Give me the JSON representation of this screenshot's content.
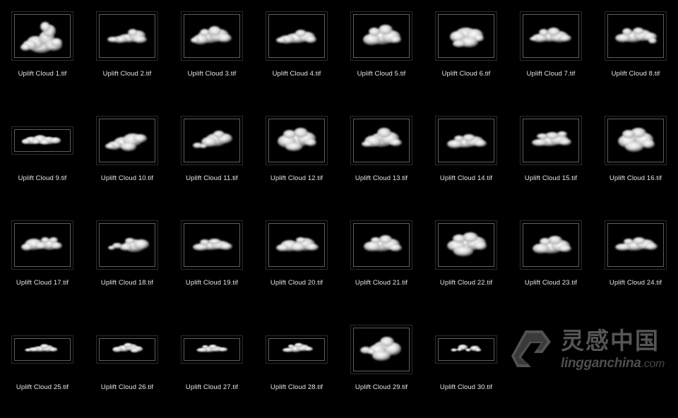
{
  "background_color": "#000000",
  "label_color": "#e6e6e6",
  "frame_border_color": "#5e5e5e",
  "grid": {
    "columns": 8,
    "rows": 4,
    "total_items": 30
  },
  "items": [
    {
      "label": "Uplift Cloud 1.tif",
      "shape": "towering-cumulus",
      "frame": "tall"
    },
    {
      "label": "Uplift Cloud 2.tif",
      "shape": "flat-wisp",
      "frame": "tall"
    },
    {
      "label": "Uplift Cloud 3.tif",
      "shape": "broad-puffy",
      "frame": "tall"
    },
    {
      "label": "Uplift Cloud 4.tif",
      "shape": "lumpy-low",
      "frame": "tall"
    },
    {
      "label": "Uplift Cloud 5.tif",
      "shape": "dome-cumulus",
      "frame": "tall"
    },
    {
      "label": "Uplift Cloud 6.tif",
      "shape": "round-blob",
      "frame": "tall"
    },
    {
      "label": "Uplift Cloud 7.tif",
      "shape": "long-flat",
      "frame": "tall"
    },
    {
      "label": "Uplift Cloud 8.tif",
      "shape": "ragged-wide",
      "frame": "tall"
    },
    {
      "label": "Uplift Cloud 9.tif",
      "shape": "panorama-bank",
      "frame": "wide"
    },
    {
      "label": "Uplift Cloud 10.tif",
      "shape": "diagonal-streak",
      "frame": "tall"
    },
    {
      "label": "Uplift Cloud 11.tif",
      "shape": "split-fragment",
      "frame": "tall"
    },
    {
      "label": "Uplift Cloud 12.tif",
      "shape": "dense-mass",
      "frame": "tall"
    },
    {
      "label": "Uplift Cloud 13.tif",
      "shape": "billowy-top",
      "frame": "tall"
    },
    {
      "label": "Uplift Cloud 14.tif",
      "shape": "stretched-low",
      "frame": "tall"
    },
    {
      "label": "Uplift Cloud 15.tif",
      "shape": "layered-bank",
      "frame": "tall"
    },
    {
      "label": "Uplift Cloud 16.tif",
      "shape": "fluffy-square",
      "frame": "tall"
    },
    {
      "label": "Uplift Cloud 17.tif",
      "shape": "wispy-scatter",
      "frame": "tall"
    },
    {
      "label": "Uplift Cloud 18.tif",
      "shape": "comet-tail",
      "frame": "tall"
    },
    {
      "label": "Uplift Cloud 19.tif",
      "shape": "horizontal-bar",
      "frame": "tall"
    },
    {
      "label": "Uplift Cloud 20.tif",
      "shape": "twin-lobe",
      "frame": "tall"
    },
    {
      "label": "Uplift Cloud 21.tif",
      "shape": "soft-oval",
      "frame": "tall"
    },
    {
      "label": "Uplift Cloud 22.tif",
      "shape": "big-cauliflower",
      "frame": "tall"
    },
    {
      "label": "Uplift Cloud 23.tif",
      "shape": "heavy-base",
      "frame": "tall"
    },
    {
      "label": "Uplift Cloud 24.tif",
      "shape": "wide-thin",
      "frame": "tall"
    },
    {
      "label": "Uplift Cloud 25.tif",
      "shape": "slim-streak",
      "frame": "wide"
    },
    {
      "label": "Uplift Cloud 26.tif",
      "shape": "knobby-line",
      "frame": "wide"
    },
    {
      "label": "Uplift Cloud 27.tif",
      "shape": "low-ribbon",
      "frame": "wide"
    },
    {
      "label": "Uplift Cloud 28.tif",
      "shape": "tufted-ribbon",
      "frame": "wide"
    },
    {
      "label": "Uplift Cloud 29.tif",
      "shape": "bright-puff",
      "frame": "tall"
    },
    {
      "label": "Uplift Cloud 30.tif",
      "shape": "three-puffs",
      "frame": "wide"
    }
  ],
  "watermark": {
    "chinese": "灵感中国",
    "english": "lingganchina",
    "domain": ".com",
    "color": "#5d5d5d"
  }
}
